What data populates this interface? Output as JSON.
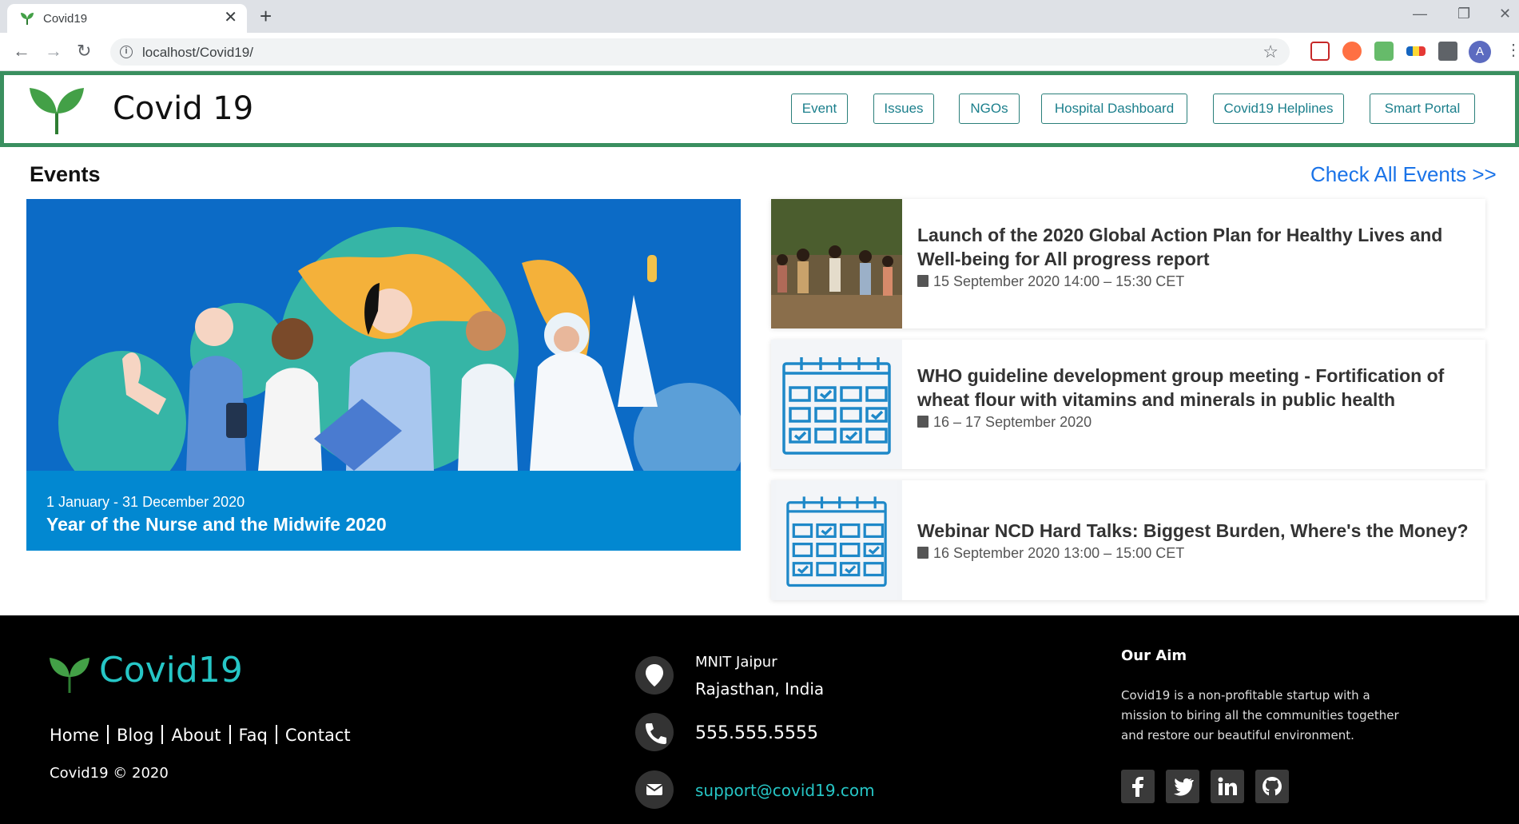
{
  "browser": {
    "tab_title": "Covid19",
    "url": "localhost/Covid19/",
    "avatar_letter": "A"
  },
  "header": {
    "brand": "Covid 19",
    "nav": [
      "Event",
      "Issues",
      "NGOs",
      "Hospital Dashboard",
      "Covid19 Helplines",
      "Smart Portal"
    ]
  },
  "events": {
    "heading": "Events",
    "check_all": "Check All Events >>",
    "featured": {
      "date": "1 January - 31 December 2020",
      "title": "Year of the Nurse and the Midwife 2020"
    },
    "list": [
      {
        "title": "Launch of the 2020 Global Action Plan for Healthy Lives and Well-being for All progress report",
        "date": "15 September 2020 14:00 – 15:30 CET",
        "thumb": "photo"
      },
      {
        "title": "WHO guideline development group meeting - Fortification of wheat flour with vitamins and minerals in public health",
        "date": "16 – 17 September 2020",
        "thumb": "calendar-icon"
      },
      {
        "title": "Webinar NCD Hard Talks: Biggest Burden, Where's the Money?",
        "date": "16 September 2020 13:00 – 15:00 CET",
        "thumb": "calendar-icon"
      }
    ]
  },
  "footer": {
    "brand": "Covid19",
    "links": [
      "Home",
      "Blog",
      "About",
      "Faq",
      "Contact"
    ],
    "copyright": "Covid19 © 2020",
    "address_line1": "MNIT Jaipur",
    "address_line2": "Rajasthan, India",
    "phone": "555.555.5555",
    "email": "support@covid19.com",
    "aim_title": "Our Aim",
    "aim_text": "Covid19 is a non-profitable startup with a mission to biring all the communities together and restore our beautiful environment.",
    "social": [
      "facebook-icon",
      "twitter-icon",
      "linkedin-icon",
      "github-icon"
    ]
  },
  "colors": {
    "header_border": "#3a8f5f",
    "nav_text": "#1b7f8c",
    "link_blue": "#1a73e8",
    "footer_accent": "#26c6c6",
    "feature_caption": "#0288d1"
  }
}
